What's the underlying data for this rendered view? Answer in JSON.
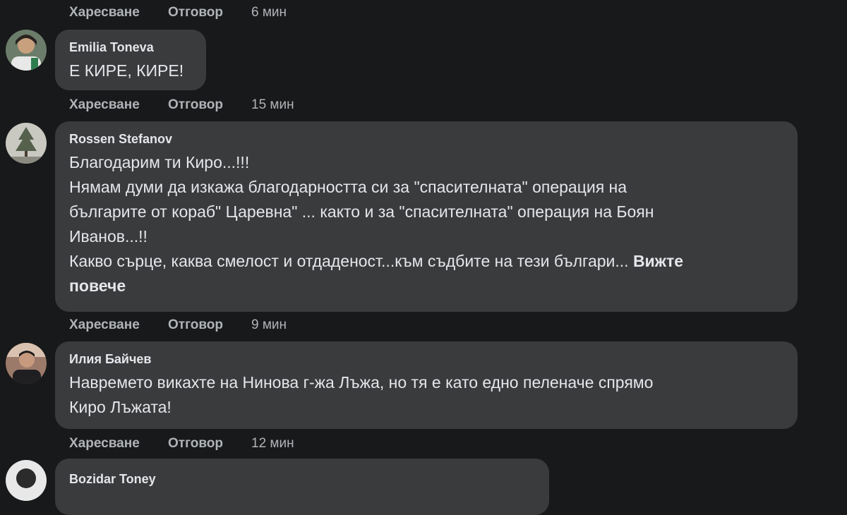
{
  "labels": {
    "like": "Харесване",
    "reply": "Отговор"
  },
  "top_actions": {
    "time": "6 мин"
  },
  "comments": [
    {
      "author": "Emilia Toneva",
      "lines": [
        "Е КИРЕ, КИРЕ!"
      ],
      "time": "15 мин"
    },
    {
      "author": "Rossen Stefanov",
      "lines": [
        "Благодарим ти Киро...!!!",
        "Нямам думи да изкажа благодарността си за \"спасителната\" операция на",
        "българите от кораб\" Царевна\" ... както и за \"спасителната\" операция на Боян",
        "Иванов...!!",
        "Какво сърце, каква смелост и отдаденост...към съдбите на тези българи..."
      ],
      "see_more_1": "Вижте",
      "see_more_2": "повече",
      "time": "9 мин"
    },
    {
      "author": "Илия Байчев",
      "lines": [
        "Навремето викахте на Нинова г-жа Лъжа, но тя е като едно пеленаче спрямо",
        "Киро Лъжата!"
      ],
      "time": "12 мин"
    },
    {
      "author": "Bozidar Toney"
    }
  ],
  "colors": {
    "background": "#18191a",
    "bubble": "#3a3b3c",
    "text": "#e4e6eb",
    "muted": "#b0b3b8"
  }
}
